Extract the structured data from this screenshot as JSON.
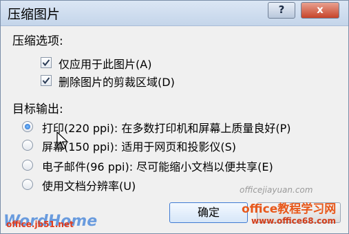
{
  "title": "压缩图片",
  "help_label": "?",
  "close_label": "x",
  "compress_section": {
    "label": "压缩选项:",
    "options": [
      {
        "label": "仅应用于此图片(A)",
        "checked": true
      },
      {
        "label": "删除图片的剪裁区域(D)",
        "checked": true
      }
    ]
  },
  "target_section": {
    "label": "目标输出:",
    "options": [
      {
        "label": "打印(220 ppi): 在多数打印机和屏幕上质量良好(P)",
        "selected": true
      },
      {
        "label": "屏幕(150 ppi): 适用于网页和投影仪(S)",
        "selected": false
      },
      {
        "label": "电子邮件(96 ppi): 尽可能缩小文档以便共享(E)",
        "selected": false
      },
      {
        "label": "使用文档分辨率(U)",
        "selected": false
      }
    ]
  },
  "buttons": {
    "ok": "确定"
  },
  "watermarks": {
    "right_url": "officejiayuan.com",
    "right_brand": "office教程学习网",
    "right_url2": "www.office68.com",
    "left_site": "office.jb51.net",
    "left_logo": "WordHome"
  }
}
